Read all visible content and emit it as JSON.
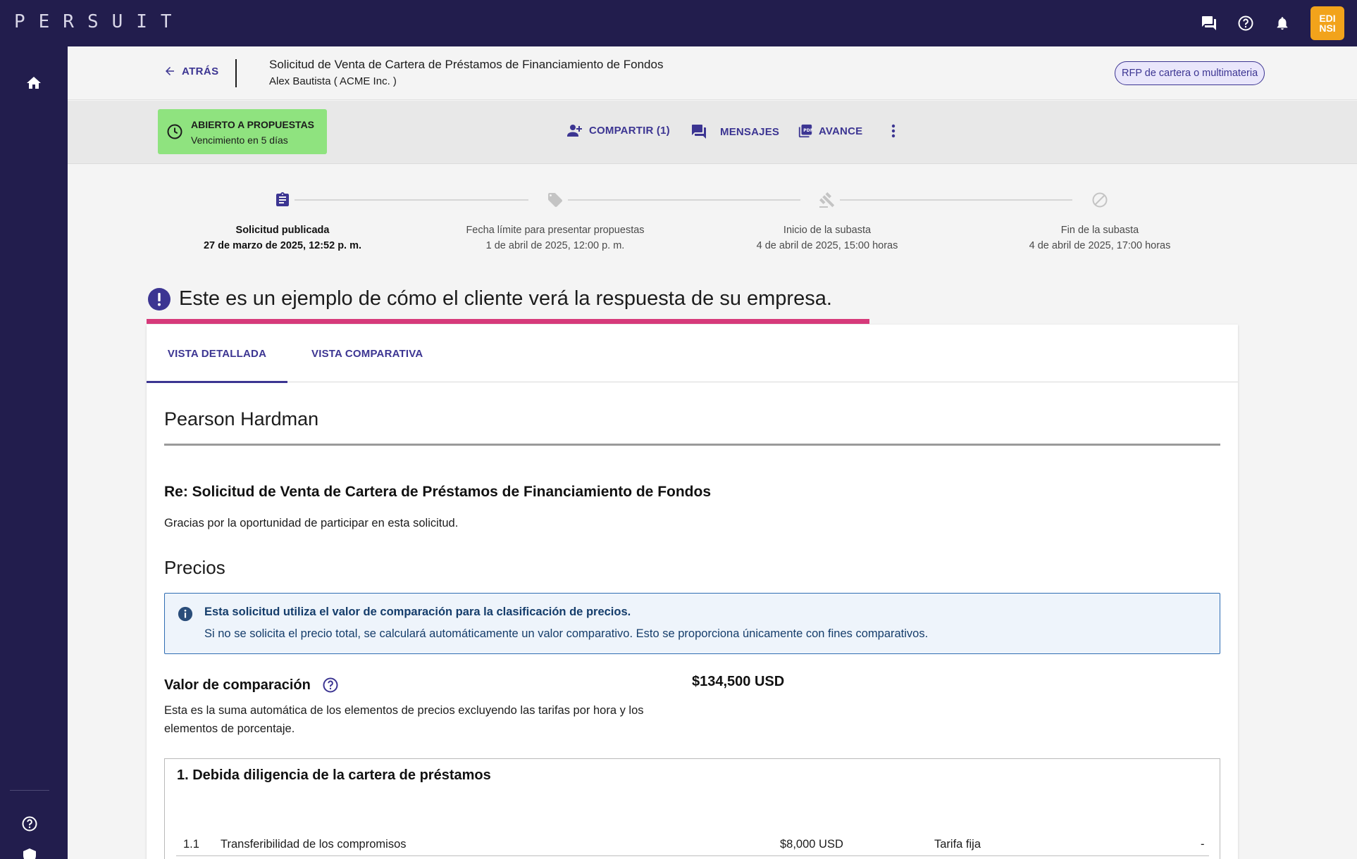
{
  "app": {
    "logo": "PERSUIT",
    "avatar_initials": "EDI NSI"
  },
  "header": {
    "back_label": "ATRÁS",
    "title": "Solicitud de Venta de Cartera de Préstamos de Financiamiento de Fondos",
    "subtitle": "Alex Bautista ( ACME Inc. )",
    "tag": "RFP de cartera o multimateria"
  },
  "status": {
    "title": "ABIERTO A PROPUESTAS",
    "subtitle": "Vencimiento en 5 días",
    "color": "#8fe37f"
  },
  "actions": {
    "share": "COMPARTIR (1)",
    "messages": "MENSAJES",
    "preview": "AVANCE"
  },
  "timeline": [
    {
      "label": "Solicitud publicada",
      "date": "27 de marzo de 2025, 12:52 p. m.",
      "icon": "clipboard-icon",
      "active": true
    },
    {
      "label": "Fecha límite para presentar propuestas",
      "date": "1 de abril de 2025, 12:00 p. m.",
      "icon": "tag-icon",
      "active": false
    },
    {
      "label": "Inicio de la subasta",
      "date": "4 de abril de 2025, 15:00 horas",
      "icon": "gavel-icon",
      "active": false
    },
    {
      "label": "Fin de la subasta",
      "date": "4 de abril de 2025, 17:00 horas",
      "icon": "block-icon",
      "active": false
    }
  ],
  "notice": {
    "text": "Este es un ejemplo de cómo el cliente verá la respuesta de su empresa.",
    "accent": "#d63a7a"
  },
  "tabs": [
    {
      "label": "VISTA DETALLADA",
      "active": true
    },
    {
      "label": "VISTA COMPARATIVA",
      "active": false
    }
  ],
  "response": {
    "firm": "Pearson Hardman",
    "re_title": "Re: Solicitud de Venta de Cartera de Préstamos de Financiamiento de Fondos",
    "thanks": "Gracias por la oportunidad de participar en esta solicitud.",
    "pricing_heading": "Precios",
    "info_title": "Esta solicitud utiliza el valor de comparación para la clasificación de precios.",
    "info_text": "Si no se solicita el precio total, se calculará automáticamente un valor comparativo. Esto se proporciona únicamente con fines comparativos.",
    "comparison_label": "Valor de comparación",
    "comparison_desc": "Esta es la suma automática de los elementos de precios excluyendo las tarifas por hora y los elementos de porcentaje.",
    "comparison_value": "$134,500 USD",
    "section_title": "1. Debida diligencia de la cartera de préstamos",
    "rows": [
      {
        "num": "1.1",
        "name": "Transferibilidad de los compromisos",
        "amount": "$8,000 USD",
        "type": "Tarifa fija",
        "extra": "-"
      }
    ]
  },
  "colors": {
    "nav": "#221d4d",
    "brand": "#3c3592",
    "info_border": "#2f6db3"
  }
}
